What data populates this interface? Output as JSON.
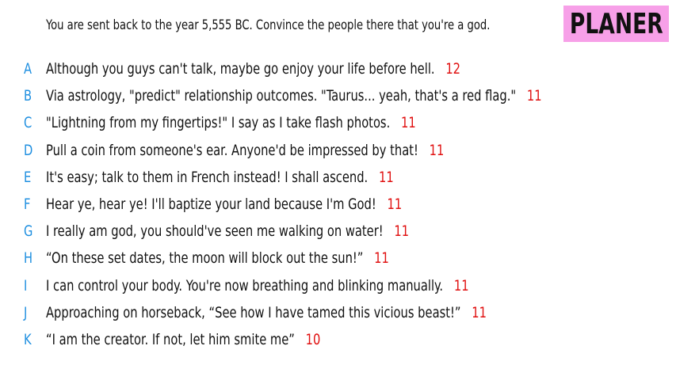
{
  "prompt": "You are sent back to the year 5,555 BC. Convince the people there that you're a god.",
  "logo": {
    "text": "PLANER",
    "bg_color": "#f7a0e8"
  },
  "colors": {
    "letter": "#1f8fe0",
    "score": "#e01010",
    "text": "#111111"
  },
  "answers": [
    {
      "letter": "A",
      "text": "Although you guys can't talk, maybe go enjoy your life before hell.",
      "score": "12"
    },
    {
      "letter": "B",
      "text": "Via astrology, \"predict\" relationship outcomes. \"Taurus... yeah, that's a red flag.\"",
      "score": "11"
    },
    {
      "letter": "C",
      "text": "\"Lightning from my fingertips!\" I say as I take flash photos.",
      "score": "11"
    },
    {
      "letter": "D",
      "text": "Pull a coin from someone's ear. Anyone'd be impressed by that!",
      "score": "11"
    },
    {
      "letter": "E",
      "text": "It's easy; talk to them in French instead! I shall ascend.",
      "score": "11"
    },
    {
      "letter": "F",
      "text": "Hear ye, hear ye! I'll baptize your land because I'm God!",
      "score": "11"
    },
    {
      "letter": "G",
      "text": "I really am god, you should've seen me walking on water!",
      "score": "11"
    },
    {
      "letter": "H",
      "text": "“On these set dates, the moon will block out the sun!”",
      "score": "11"
    },
    {
      "letter": "I",
      "text": "I can control your body. You're now breathing and blinking manually.",
      "score": "11"
    },
    {
      "letter": "J",
      "text": "Approaching on horseback, “See how I have tamed this vicious beast!”",
      "score": "11"
    },
    {
      "letter": "K",
      "text": "“I am the creator. If not, let him smite me”",
      "score": "10"
    }
  ]
}
